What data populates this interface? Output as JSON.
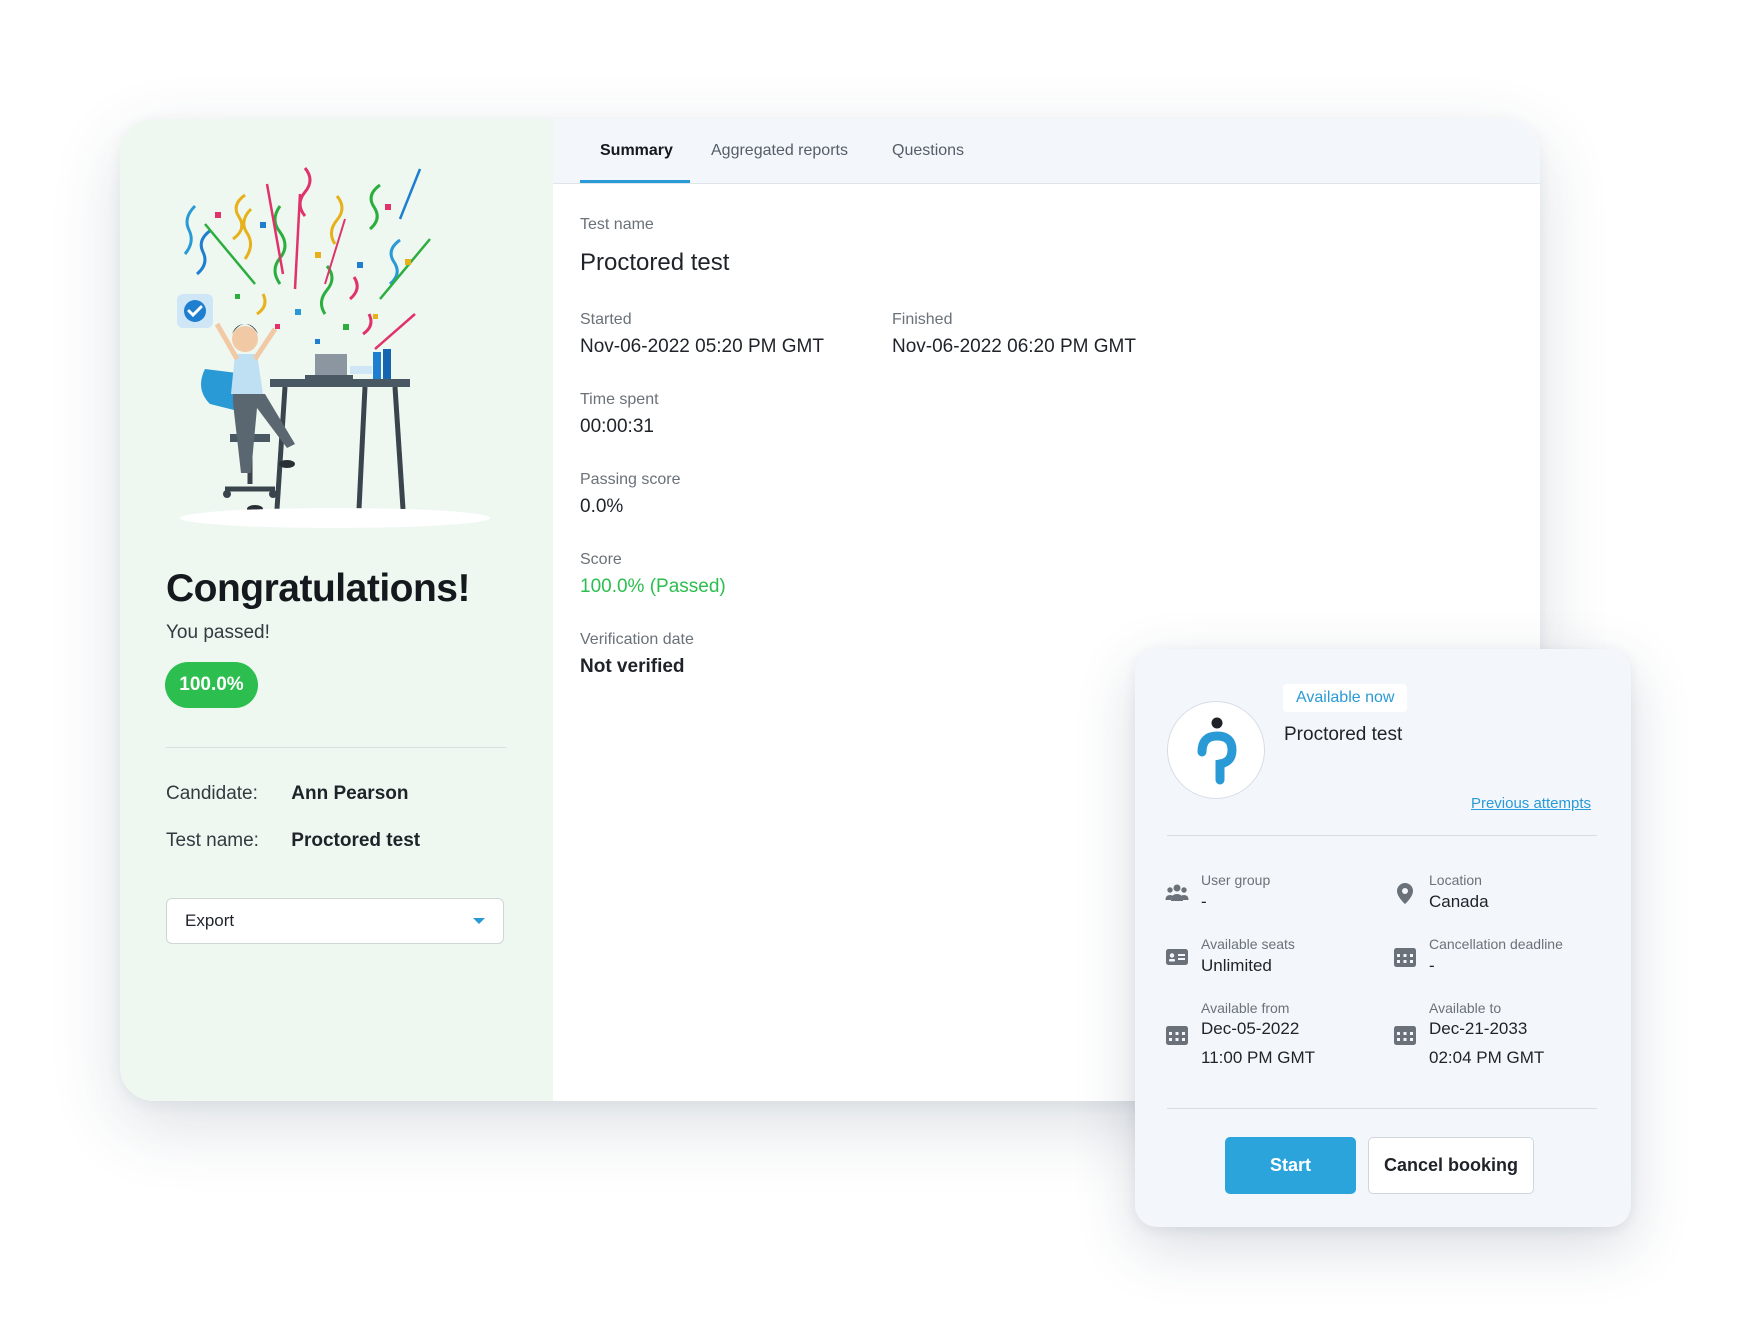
{
  "summary": {
    "congrats_title": "Congratulations!",
    "passed_text": "You passed!",
    "score_badge": "100.0%",
    "candidate_label": "Candidate:",
    "candidate_value": "Ann Pearson",
    "testname_label": "Test name:",
    "testname_value": "Proctored test",
    "export_label": "Export"
  },
  "tabs": [
    "Summary",
    "Aggregated reports",
    "Questions"
  ],
  "active_tab": "Summary",
  "details": {
    "test_name_label": "Test name",
    "test_name_value": "Proctored test",
    "started_label": "Started",
    "started_value": "Nov-06-2022 05:20 PM GMT",
    "finished_label": "Finished",
    "finished_value": "Nov-06-2022 06:20 PM GMT",
    "time_spent_label": "Time spent",
    "time_spent_value": "00:00:31",
    "passing_score_label": "Passing score",
    "passing_score_value": "0.0%",
    "score_label": "Score",
    "score_value": "100.0% (Passed)",
    "verification_label": "Verification date",
    "verification_value": "Not verified"
  },
  "booking": {
    "badge": "Available now",
    "title": "Proctored test",
    "previous_attempts": "Previous attempts",
    "user_group_label": "User group",
    "user_group_value": "-",
    "location_label": "Location",
    "location_value": "Canada",
    "seats_label": "Available seats",
    "seats_value": "Unlimited",
    "cancellation_label": "Cancellation deadline",
    "cancellation_value": "-",
    "from_label": "Available from",
    "from_date": "Dec-05-2022",
    "from_time": "11:00 PM GMT",
    "to_label": "Available to",
    "to_date": "Dec-21-2033",
    "to_time": "02:04 PM GMT",
    "start_button": "Start",
    "cancel_button": "Cancel booking"
  },
  "colors": {
    "accent": "#2a9ad6",
    "success": "#2cbe4e",
    "left_panel_bg": "#eef8f1",
    "card_bg": "#f3f7fc"
  },
  "icons": [
    "checkmark-badge-icon",
    "chevron-down-icon",
    "proctor-logo-icon",
    "users-icon",
    "location-pin-icon",
    "seat-card-icon",
    "calendar-icon"
  ]
}
